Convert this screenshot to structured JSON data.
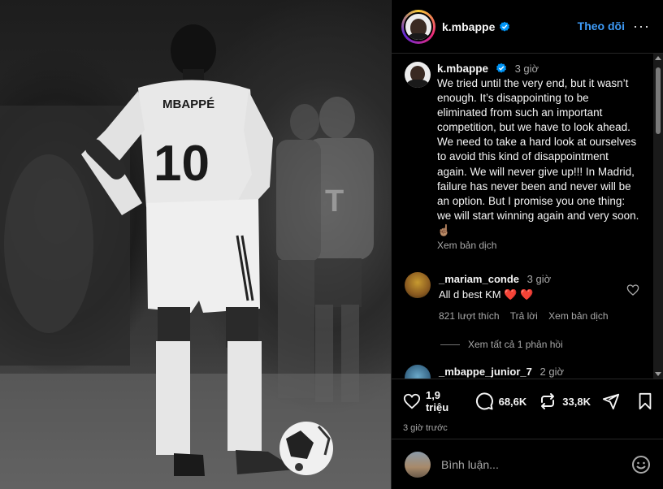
{
  "post": {
    "jersey_name": "MBAPPÉ",
    "jersey_number": "10"
  },
  "header": {
    "username": "k.mbappe",
    "follow_label": "Theo dõi",
    "more_label": "···"
  },
  "caption": {
    "username": "k.mbappe",
    "time": "3 giờ",
    "text": "We tried until the very end, but it wasn’t enough. It’s disappointing to be eliminated from such an important competition, but we have to look ahead. We need to take a hard look at ourselves to avoid this kind of disappointment again. We will never give up!!! In Madrid, failure has never been and never will be an option. But I promise you one thing: we will start winning again and very soon.☝🏽",
    "translate": "Xem bản dịch"
  },
  "comments": [
    {
      "username": "_mariam_conde",
      "time": "3 giờ",
      "text": "All d best KM ❤️ ❤️",
      "likes": "821 lượt thích",
      "reply": "Trả lời",
      "translate": "Xem bản dịch",
      "view_replies": "Xem tất cả 1 phản hồi"
    },
    {
      "username": "_mbappe_junior_7",
      "time": "2 giờ",
      "text": "🔥👏"
    }
  ],
  "actions": {
    "likes": "1,9 triệu",
    "comments": "68,6K",
    "reposts": "33,8K"
  },
  "posted_ago": "3 giờ trước",
  "comment_box": {
    "placeholder": "Bình luận..."
  },
  "colors": {
    "follow": "#3e9bf7",
    "verified": "#0095f6",
    "heart": "#ff3040"
  }
}
